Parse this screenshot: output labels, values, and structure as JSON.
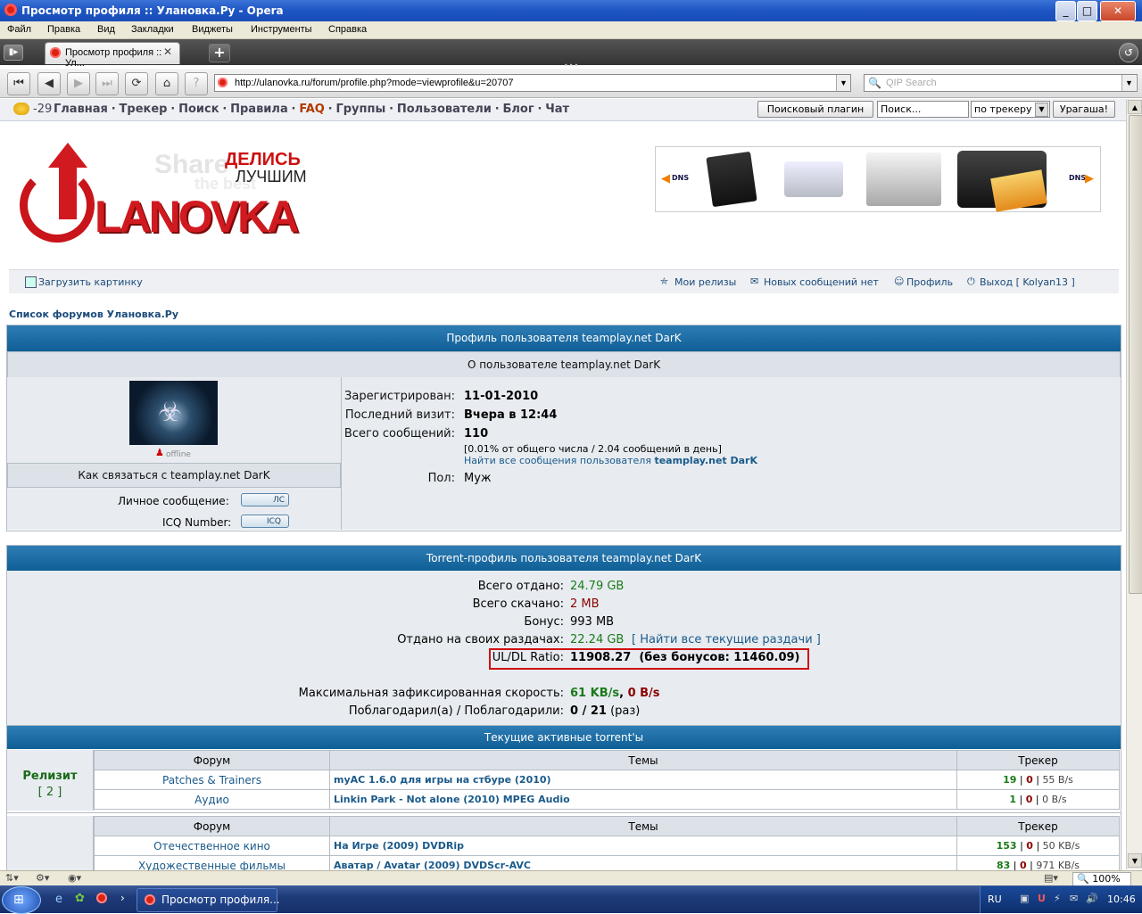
{
  "window": {
    "title": "Просмотр профиля :: Улановка.Ру - Opera"
  },
  "menu": [
    "Файл",
    "Правка",
    "Вид",
    "Закладки",
    "Виджеты",
    "Инструменты",
    "Справка"
  ],
  "tab": {
    "label": "Просмотр профиля :: Ул..."
  },
  "address": {
    "url": "http://ulanovka.ru/forum/profile.php?mode=viewprofile&u=20707",
    "search_placeholder": "QIP Search"
  },
  "sitebar": {
    "temp": "-29",
    "links": [
      "Главная",
      "Трекер",
      "Поиск",
      "Правила",
      "FAQ",
      "Группы",
      "Пользователи",
      "Блог",
      "Чат"
    ],
    "separator": "·",
    "plugin_button": "Поисковый плагин",
    "search_placeholder": "Поиск...",
    "search_scope": "по трекеру",
    "go_button": "Урагаша!"
  },
  "logo": {
    "share": "Share",
    "the_best": "the best",
    "tagline1": "ДЕЛИСЬ",
    "tagline2": "ЛУЧШИМ",
    "name": "LANOVKA"
  },
  "banner": {
    "brand_left": "DNS",
    "brand_right": "DNS"
  },
  "userbar": {
    "upload": "Загрузить картинку",
    "my_releases": "Мои релизы",
    "new_messages": "Новых сообщений нет",
    "profile": "Профиль",
    "logout": "Выход [ Kolyan13 ]"
  },
  "breadcrumb": "Список форумов Улановка.Ру",
  "profile": {
    "header": "Профиль пользователя teamplay.net DarK",
    "about": "О пользователе teamplay.net DarK",
    "status": "offline",
    "contact_header": "Как связаться с teamplay.net DarK",
    "pm_label": "Личное сообщение:",
    "icq_label": "ICQ Number:",
    "pm_btn": "ЛС",
    "icq_btn": "ICQ",
    "registered_label": "Зарегистрирован:",
    "registered": "11-01-2010",
    "last_visit_label": "Последний визит:",
    "last_visit": "Вчера в 12:44",
    "posts_label": "Всего сообщений:",
    "posts": "110",
    "posts_note": "[0.01% от общего числа / 2.04 сообщений в день]",
    "find_posts_prefix": "Найти все сообщения пользователя",
    "find_posts_user": "teamplay.net DarK",
    "gender_label": "Пол:",
    "gender": "Муж"
  },
  "torrent": {
    "header": "Torrent-профиль пользователя teamplay.net DarK",
    "uploaded_label": "Всего отдано:",
    "uploaded": "24.79 GB",
    "downloaded_label": "Всего скачано:",
    "downloaded": "2 MB",
    "bonus_label": "Бонус:",
    "bonus": "993 MB",
    "own_label": "Отдано на своих раздачах:",
    "own": "22.24 GB",
    "own_link": "[ Найти все текущие раздачи ]",
    "ratio_label": "UL/DL Ratio:",
    "ratio": "11908.27",
    "ratio_nobonus": "(без бонусов: 11460.09)",
    "speed_label": "Максимальная зафиксированная скорость:",
    "speed_up": "61 KB/s",
    "speed_down": "0 B/s",
    "thanks_label": "Поблагодарил(а) / Поблагодарили:",
    "thanks": "0 / 21",
    "thanks_unit": "(раз)"
  },
  "active": {
    "header": "Текущие активные torrent'ы",
    "seeding_label": "Релизит",
    "seeding_count": "[ 2 ]",
    "col_forum": "Форум",
    "col_topics": "Темы",
    "col_tracker": "Трекер",
    "seeding_rows": [
      {
        "forum": "Patches & Trainers",
        "topic": "myAC 1.6.0 для игры на стбуре (2010)",
        "seeds": "19",
        "leech": "0",
        "speed": "55 B/s"
      },
      {
        "forum": "Аудио",
        "topic": "Linkin Park - Not alone (2010) MPEG Audio",
        "seeds": "1",
        "leech": "0",
        "speed": "0 B/s"
      }
    ],
    "other_rows": [
      {
        "forum": "Отечественное кино",
        "topic": "На Игре (2009) DVDRip",
        "seeds": "153",
        "leech": "0",
        "speed": "50 KB/s"
      },
      {
        "forum": "Художественные фильмы",
        "topic": "Аватар / Avatar (2009) DVDScr-AVC",
        "seeds": "83",
        "leech": "0",
        "speed": "971 KB/s"
      }
    ]
  },
  "statusbar": {
    "zoom": "100%"
  },
  "taskbar": {
    "task": "Просмотр профиля...",
    "lang": "RU",
    "time": "10:46"
  },
  "colors": {
    "accent_red": "#cc1010",
    "header_blue": "#1a6ea5",
    "green": "#1a7a1a",
    "dark_red": "#8b0000"
  }
}
